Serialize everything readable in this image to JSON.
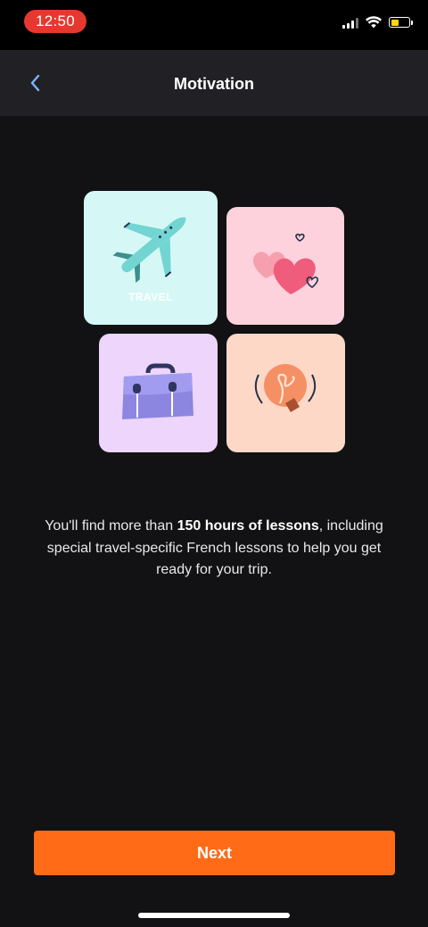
{
  "status_bar": {
    "time": "12:50",
    "signal_icon": "cellular-signal-icon",
    "wifi_icon": "wifi-icon",
    "battery_icon": "battery-icon",
    "battery_level": 0.45,
    "battery_color": "#ffd60a",
    "time_pill_color": "#e5392f"
  },
  "nav": {
    "back_icon": "chevron-left-icon",
    "title": "Motivation"
  },
  "cards": [
    {
      "id": "travel",
      "label": "TRAVEL",
      "icon": "airplane-icon",
      "color": "#d5f8f7"
    },
    {
      "id": "love",
      "icon": "hearts-icon",
      "color": "#fdd2dd"
    },
    {
      "id": "work",
      "icon": "briefcase-icon",
      "color": "#eed5fb"
    },
    {
      "id": "idea",
      "icon": "lightbulb-icon",
      "color": "#fdd8c7"
    }
  ],
  "description": {
    "before": "You'll find more than ",
    "bold": "150 hours of lessons",
    "after": ", including special travel-specific French lessons to help you get ready for your trip."
  },
  "next_button": {
    "label": "Next",
    "color": "#ff6b16"
  }
}
